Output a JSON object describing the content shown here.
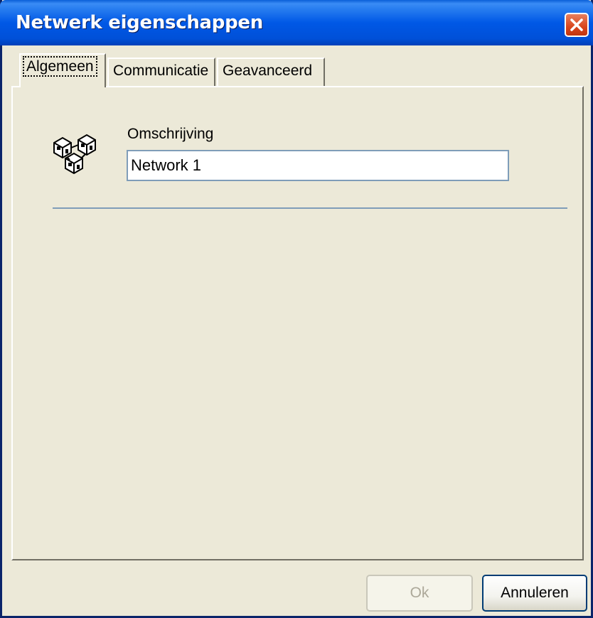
{
  "window": {
    "title": "Netwerk eigenschappen"
  },
  "tabs": [
    {
      "label": "Algemeen",
      "active": true
    },
    {
      "label": "Communicatie",
      "active": false
    },
    {
      "label": "Geavanceerd",
      "active": false
    }
  ],
  "general": {
    "description_label": "Omschrijving",
    "description_value": "Network 1",
    "icon": "network-cubes-icon"
  },
  "buttons": {
    "ok_label": "Ok",
    "ok_enabled": false,
    "cancel_label": "Annuleren"
  },
  "colors": {
    "titlebar": "#0058e6",
    "face": "#ece9d8",
    "divider": "#7f9db9",
    "close": "#d9451c"
  }
}
